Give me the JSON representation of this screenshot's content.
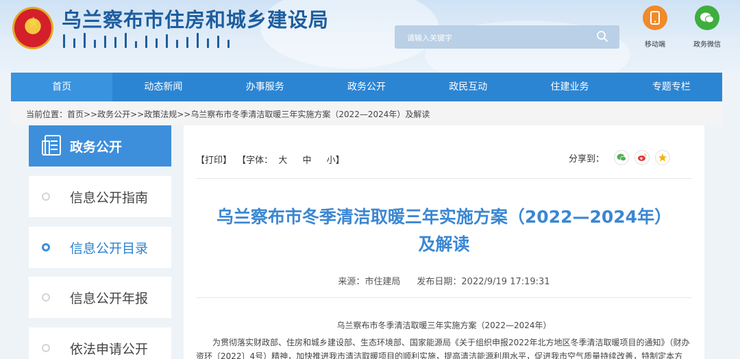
{
  "header": {
    "site_title": "乌兰察布市住房和城乡建设局",
    "search_placeholder": "请输入关键字",
    "quick_links": [
      {
        "label": "移动端",
        "icon": "phone-icon",
        "color": "#f08a2a"
      },
      {
        "label": "政务微信",
        "icon": "wechat-icon",
        "color": "#3eae3e"
      }
    ]
  },
  "nav": {
    "items": [
      "首页",
      "动态新闻",
      "办事服务",
      "政务公开",
      "政民互动",
      "住建业务",
      "专题专栏"
    ]
  },
  "breadcrumb": {
    "text": "当前位置：首页>>政务公开>>政策法规>>乌兰察布市冬季清洁取暖三年实施方案（2022—2024年）及解读"
  },
  "sidebar": {
    "title": "政务公开",
    "items": [
      {
        "label": "信息公开指南",
        "active": false
      },
      {
        "label": "信息公开目录",
        "active": true
      },
      {
        "label": "信息公开年报",
        "active": false
      },
      {
        "label": "依法申请公开",
        "active": false
      }
    ]
  },
  "article": {
    "toolbar": {
      "print": "【打印】",
      "font_label": "【字体：",
      "font_large": "大",
      "font_medium": "中",
      "font_small": "小】"
    },
    "share_label": "分享到：",
    "share_icons": [
      "wechat-icon",
      "weibo-icon",
      "qzone-icon"
    ],
    "title_line1": "乌兰察布市冬季清洁取暖三年实施方案（2022—2024年）",
    "title_line2": "及解读",
    "source": "来源：市住建局",
    "publish_date": "发布日期：2022/9/19 17:19:31",
    "sub_title": "乌兰察布市冬季清洁取暖三年实施方案（2022—2024年）",
    "paragraph": "为贯彻落实财政部、住房和城乡建设部、生态环境部、国家能源局《关于组织申报2022年北方地区冬季清洁取暖项目的通知》（财办资环〔2022〕4号）精神，加快推进我市清洁取暖项目的顺利实施，提高清洁能源利用水平，促进我市空气质量持续改善，特制定本方"
  },
  "colors": {
    "brand_blue": "#2c85d3",
    "title_blue": "#3b87d2",
    "sidebar_head": "#3d8fdc"
  }
}
